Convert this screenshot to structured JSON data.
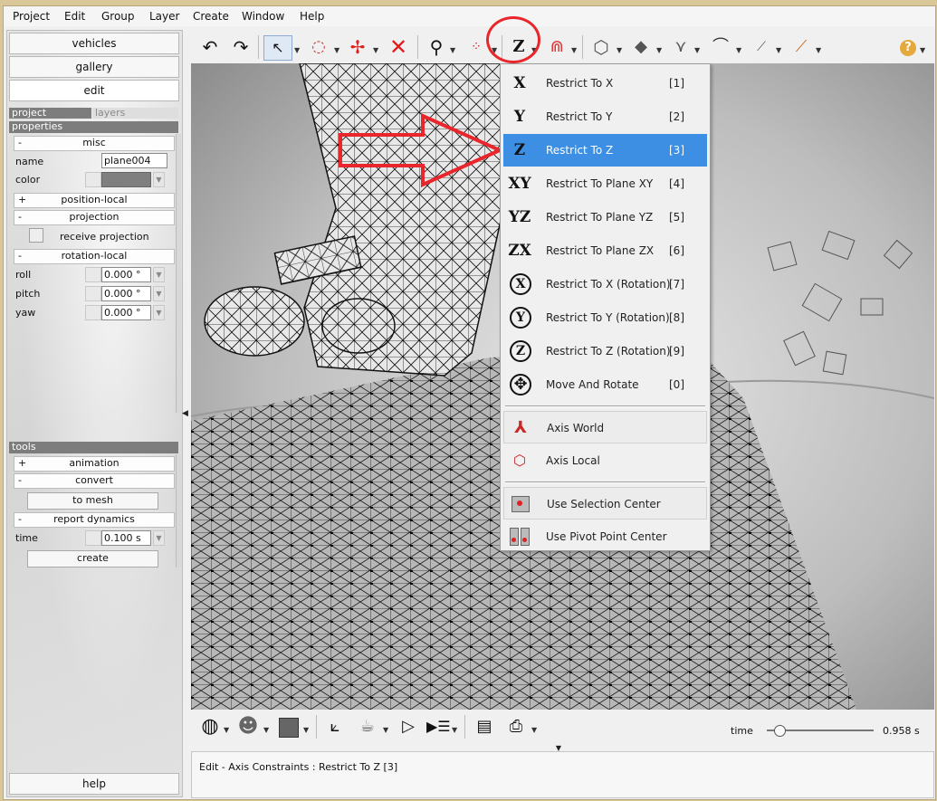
{
  "menubar": {
    "items": [
      "Project",
      "Edit",
      "Group",
      "Layer",
      "Create",
      "Window",
      "Help"
    ]
  },
  "left_panel": {
    "nav": {
      "vehicles": "vehicles",
      "gallery": "gallery",
      "edit": "edit"
    },
    "tabs": {
      "project": "project",
      "layers": "layers"
    },
    "properties": {
      "title": "properties",
      "misc": {
        "sign": "-",
        "label": "misc"
      },
      "name_label": "name",
      "name_value": "plane004",
      "color_label": "color",
      "color_value": "#7f7f7f",
      "position_local": {
        "sign": "+",
        "label": "position-local"
      },
      "projection": {
        "sign": "-",
        "label": "projection"
      },
      "receive_projection": "receive projection",
      "rotation_local": {
        "sign": "-",
        "label": "rotation-local"
      },
      "roll_label": "roll",
      "roll_value": "0.000 °",
      "pitch_label": "pitch",
      "pitch_value": "0.000 °",
      "yaw_label": "yaw",
      "yaw_value": "0.000 °"
    },
    "tools": {
      "title": "tools",
      "animation": {
        "sign": "+",
        "label": "animation"
      },
      "convert": {
        "sign": "-",
        "label": "convert"
      },
      "to_mesh": "to mesh",
      "report_dynamics": {
        "sign": "-",
        "label": "report dynamics"
      },
      "time_label": "time",
      "time_value": "0.100 s",
      "create": "create"
    },
    "help": "help"
  },
  "toolbar": {
    "axis_button_label": "Z"
  },
  "axis_menu": {
    "items": [
      {
        "icon": "X",
        "label": "Restrict To X",
        "shortcut": "[1]"
      },
      {
        "icon": "Y",
        "label": "Restrict To Y",
        "shortcut": "[2]"
      },
      {
        "icon": "Z",
        "label": "Restrict To Z",
        "shortcut": "[3]"
      },
      {
        "icon": "XY",
        "label": "Restrict To Plane XY",
        "shortcut": "[4]"
      },
      {
        "icon": "YZ",
        "label": "Restrict To Plane YZ",
        "shortcut": "[5]"
      },
      {
        "icon": "ZX",
        "label": "Restrict To Plane ZX",
        "shortcut": "[6]"
      },
      {
        "icon": "X",
        "label": "Restrict To X (Rotation)",
        "shortcut": "[7]"
      },
      {
        "icon": "Y",
        "label": "Restrict To Y (Rotation)",
        "shortcut": "[8]"
      },
      {
        "icon": "Z",
        "label": "Restrict To Z (Rotation)",
        "shortcut": "[9]"
      },
      {
        "icon": "move-rotate-icon",
        "label": "Move And Rotate",
        "shortcut": "[0]"
      }
    ],
    "selected_index": 2,
    "axis_world": "Axis World",
    "axis_local": "Axis Local",
    "use_selection_center": "Use Selection Center",
    "use_pivot_point_center": "Use Pivot Point Center"
  },
  "bottom_toolbar": {
    "time_label": "time",
    "time_value": "0.958 s",
    "time_fraction": 0.11
  },
  "status": {
    "text": "Edit - Axis Constraints : Restrict To Z [3]"
  },
  "colors": {
    "highlight": "#3d8fe4",
    "annotation_red": "#e8262b",
    "section_gray": "#7d7d7d"
  }
}
